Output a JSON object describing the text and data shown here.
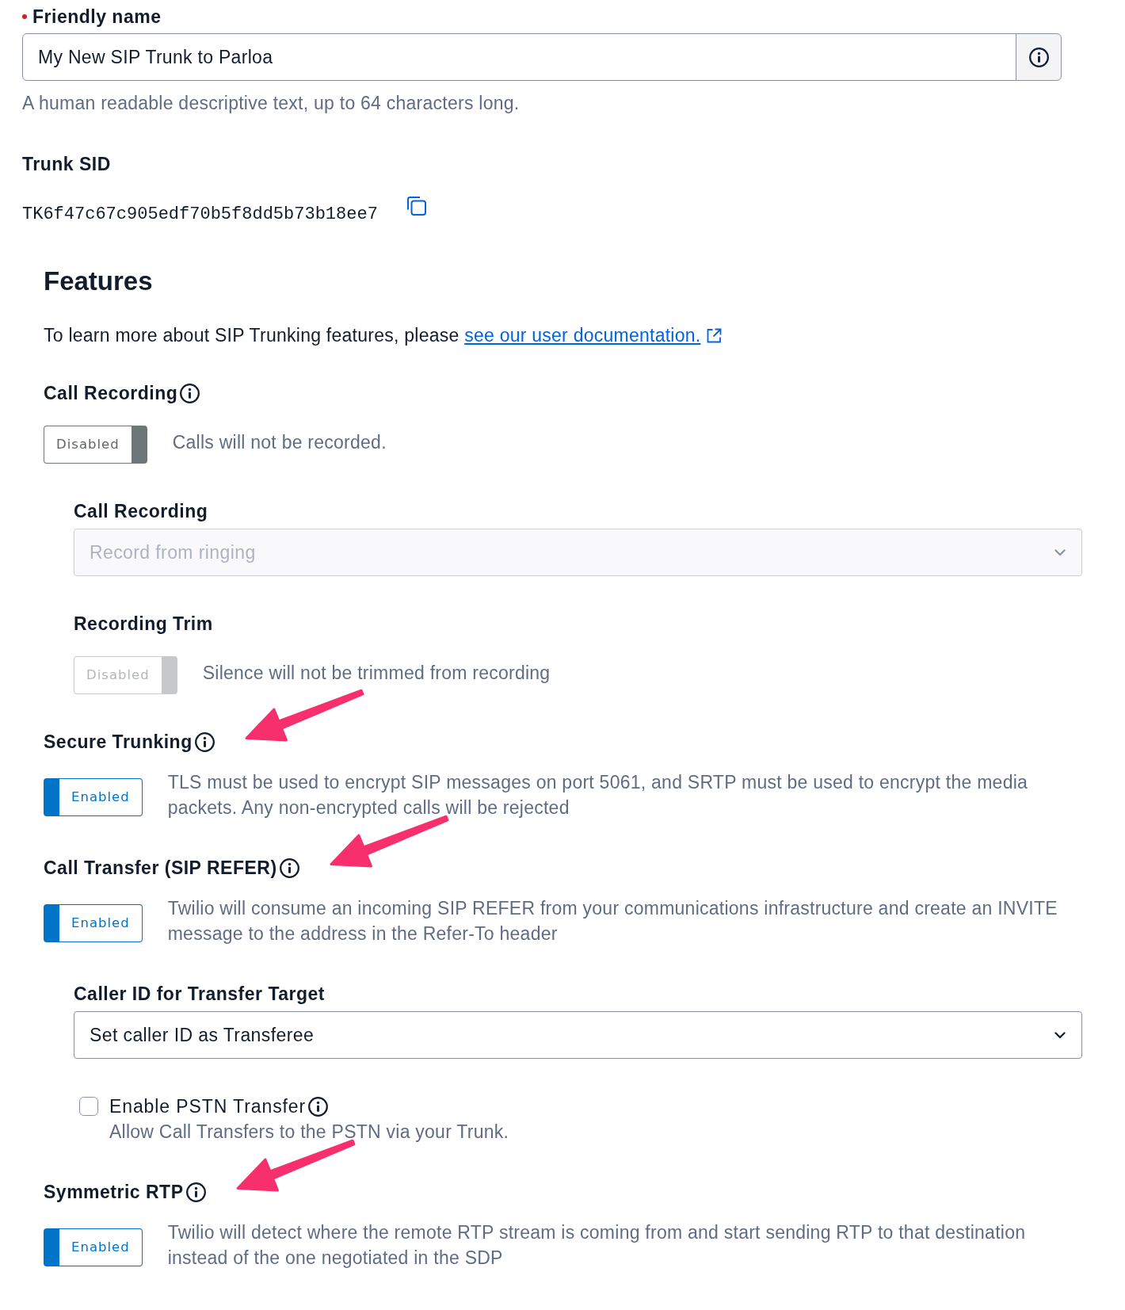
{
  "friendly_name": {
    "label": "Friendly name",
    "required": true,
    "value": "My New SIP Trunk to Parloa",
    "help": "A human readable descriptive text, up to 64 characters long."
  },
  "trunk_sid": {
    "label": "Trunk SID",
    "value": "TK6f47c67c905edf70b5f8dd5b73b18ee7"
  },
  "features": {
    "title": "Features",
    "intro": "To learn more about SIP Trunking features, please",
    "link": "see our user documentation.",
    "items": [
      {
        "kind": "toggle",
        "label": "Call Recording",
        "info_icon": true,
        "arrow": false,
        "toggle": {
          "label": "Disabled",
          "on": false,
          "disabled": false
        },
        "description": "Calls will not be recorded.",
        "sub_settings": [
          {
            "kind": "select",
            "label": "Call Recording",
            "info_icon": false,
            "value": "Record from ringing",
            "disabled": true
          },
          {
            "kind": "toggle",
            "label": "Recording Trim",
            "info_icon": false,
            "toggle": {
              "label": "Disabled",
              "on": false,
              "disabled": true
            },
            "description": "Silence will not be trimmed from recording"
          }
        ]
      },
      {
        "kind": "toggle",
        "label": "Secure Trunking",
        "info_icon": true,
        "arrow": true,
        "toggle": {
          "label": "Enabled",
          "on": true,
          "disabled": false
        },
        "description": "TLS must be used to encrypt SIP messages on port 5061, and SRTP must be used to encrypt the media packets. Any non-encrypted calls will be rejected"
      },
      {
        "kind": "toggle",
        "label": "Call Transfer (SIP REFER)",
        "info_icon": true,
        "arrow": true,
        "toggle": {
          "label": "Enabled",
          "on": true,
          "disabled": false
        },
        "description": "Twilio will consume an incoming SIP REFER from your communications infrastructure and create an INVITE message to the address in the Refer-To header",
        "sub_settings": [
          {
            "kind": "select",
            "label": "Caller ID for Transfer Target",
            "info_icon": false,
            "value": "Set caller ID as Transferee",
            "disabled": false
          },
          {
            "kind": "checkbox",
            "label": "Enable PSTN Transfer",
            "info_icon": true,
            "checked": false,
            "description": "Allow Call Transfers to the PSTN via your Trunk."
          }
        ]
      },
      {
        "kind": "toggle",
        "label": "Symmetric RTP",
        "info_icon": true,
        "arrow": true,
        "toggle": {
          "label": "Enabled",
          "on": true,
          "disabled": false
        },
        "description": "Twilio will detect where the remote RTP stream is coming from and start sending RTP to that destination instead of the one negotiated in the SDP"
      }
    ]
  }
}
